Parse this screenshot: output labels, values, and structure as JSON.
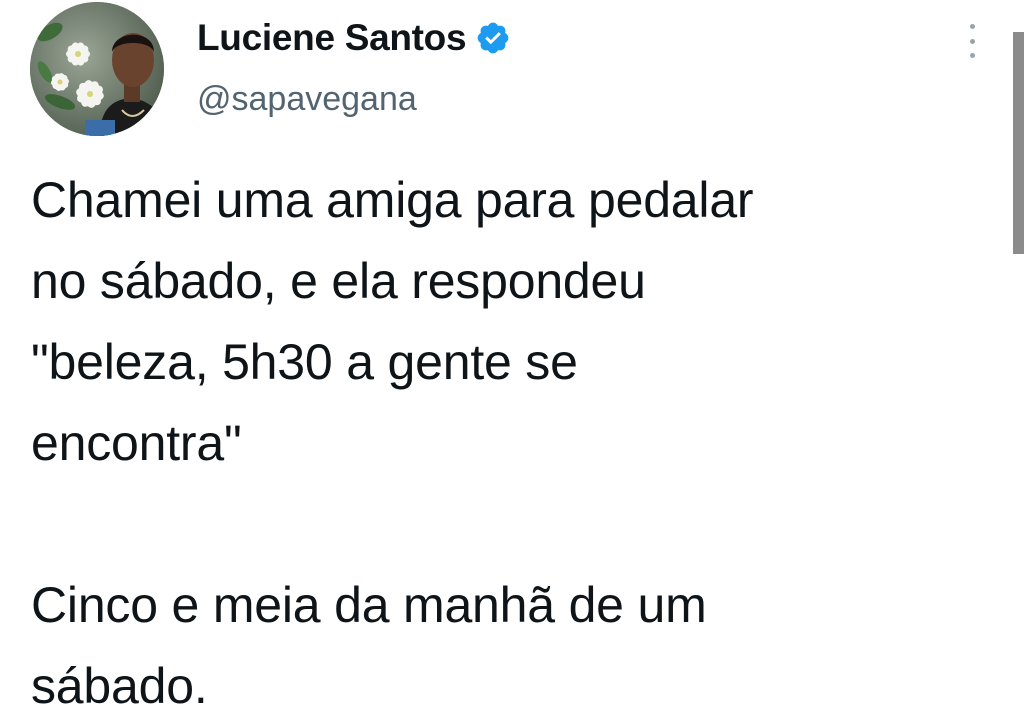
{
  "tweet": {
    "author": {
      "display_name": "Luciene Santos",
      "handle": "@sapavegana",
      "verified": true,
      "avatar_icon": "profile-photo"
    },
    "text_lines": [
      "Chamei uma amiga para pedalar",
      "no sábado, e ela respondeu",
      "\"beleza, 5h30 a gente se",
      "encontra\"",
      "",
      "Cinco e meia da manhã de um",
      "sábado."
    ],
    "menu_icon": "more-vertical-icon"
  },
  "colors": {
    "text": "#0f1419",
    "secondary_text": "#536471",
    "verified_badge": "#1d9bf0",
    "background": "#ffffff"
  }
}
